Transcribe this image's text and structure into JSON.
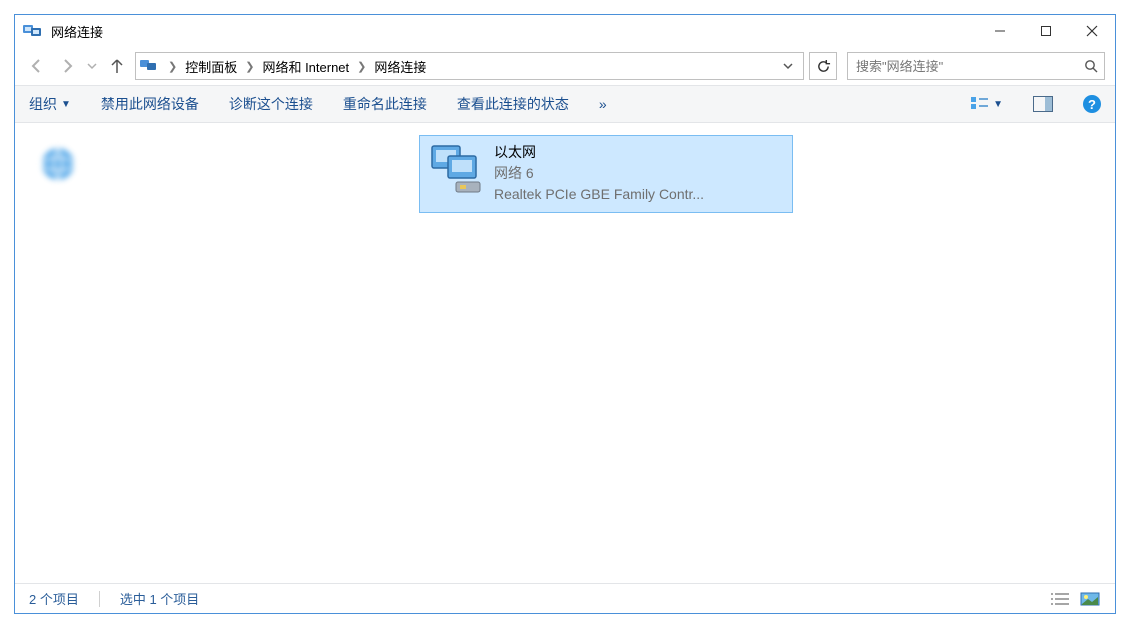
{
  "window": {
    "title": "网络连接"
  },
  "breadcrumb": {
    "items": [
      "控制面板",
      "网络和 Internet",
      "网络连接"
    ]
  },
  "search": {
    "placeholder": "搜索\"网络连接\""
  },
  "toolbar": {
    "organize": "组织",
    "disable": "禁用此网络设备",
    "diagnose": "诊断这个连接",
    "rename": "重命名此连接",
    "viewstatus": "查看此连接的状态",
    "overflow": "»"
  },
  "connections": [
    {
      "name": "",
      "status": "",
      "device": ""
    },
    {
      "name": "以太网",
      "status": "网络 6",
      "device": "Realtek PCIe GBE Family Contr..."
    }
  ],
  "statusbar": {
    "count": "2 个项目",
    "selected": "选中 1 个项目"
  }
}
